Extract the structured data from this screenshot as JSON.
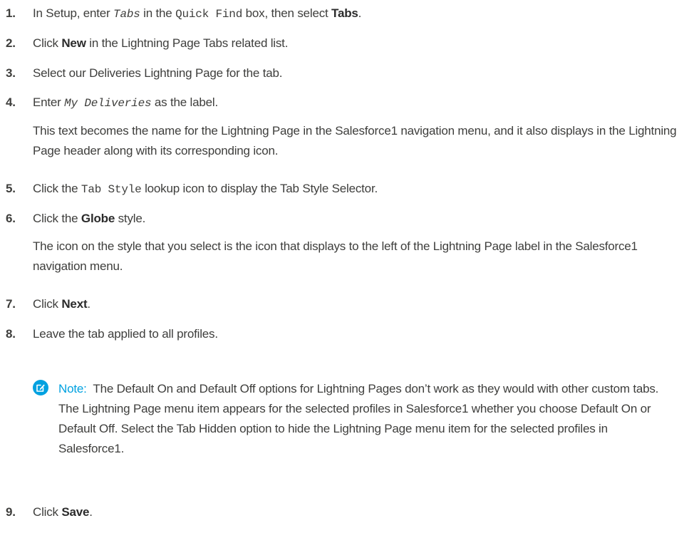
{
  "steps": [
    {
      "num": "1.",
      "pre": "In Setup, enter ",
      "code": "Tabs",
      "mid": " in the ",
      "code2": "Quick Find",
      "post": " box, then select ",
      "bold": "Tabs",
      "end": "."
    },
    {
      "num": "2.",
      "pre": "Click ",
      "bold": "New",
      "post": " in the Lightning Page Tabs related list."
    },
    {
      "num": "3.",
      "text": "Select our Deliveries Lightning Page for the tab."
    },
    {
      "num": "4.",
      "pre": "Enter ",
      "code": "My Deliveries",
      "post": " as the label.",
      "para": "This text becomes the name for the Lightning Page in the Salesforce1 navigation menu, and it also displays in the Lightning Page header along with its corresponding icon."
    },
    {
      "num": "5.",
      "pre": "Click the ",
      "code": "Tab Style",
      "post": " lookup icon to display the Tab Style Selector."
    },
    {
      "num": "6.",
      "pre": "Click the ",
      "bold": "Globe",
      "post": " style.",
      "para": "The icon on the style that you select is the icon that displays to the left of the Lightning Page label in the Salesforce1 navigation menu."
    },
    {
      "num": "7.",
      "pre": "Click ",
      "bold": "Next",
      "post": "."
    },
    {
      "num": "8.",
      "text": "Leave the tab applied to all profiles."
    },
    {
      "num": "9.",
      "pre": "Click ",
      "bold": "Save",
      "post": "."
    }
  ],
  "note": {
    "label": "Note:",
    "text": "The Default On and Default Off options for Lightning Pages don’t work as they would with other custom tabs. The Lightning Page menu item appears for the selected profiles in Salesforce1 whether you choose Default On or Default Off. Select the Tab Hidden option to hide the Lightning Page menu item for the selected profiles in Salesforce1.",
    "icon": "note-edit-icon",
    "color": "#00a1e0"
  }
}
